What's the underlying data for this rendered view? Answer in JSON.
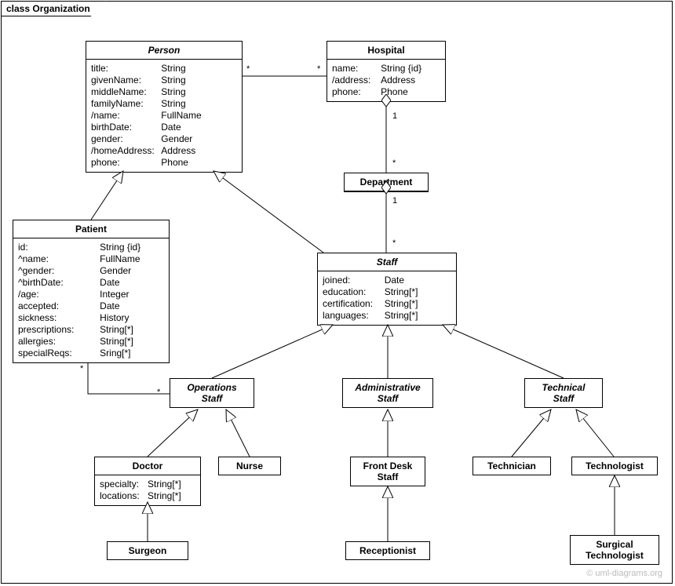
{
  "frame": {
    "label": "class Organization"
  },
  "watermark": "© uml-diagrams.org",
  "classes": {
    "person": {
      "name": "Person",
      "attrs": [
        {
          "n": "title:",
          "t": "String"
        },
        {
          "n": "givenName:",
          "t": "String"
        },
        {
          "n": "middleName:",
          "t": "String"
        },
        {
          "n": "familyName:",
          "t": "String"
        },
        {
          "n": "/name:",
          "t": "FullName"
        },
        {
          "n": "birthDate:",
          "t": "Date"
        },
        {
          "n": "gender:",
          "t": "Gender"
        },
        {
          "n": "/homeAddress:",
          "t": "Address"
        },
        {
          "n": "phone:",
          "t": "Phone"
        }
      ]
    },
    "hospital": {
      "name": "Hospital",
      "attrs": [
        {
          "n": "name:",
          "t": "String {id}"
        },
        {
          "n": "/address:",
          "t": "Address"
        },
        {
          "n": "phone:",
          "t": "Phone"
        }
      ]
    },
    "department": {
      "name": "Department"
    },
    "patient": {
      "name": "Patient",
      "attrs": [
        {
          "n": "id:",
          "t": "String {id}"
        },
        {
          "n": "^name:",
          "t": "FullName"
        },
        {
          "n": "^gender:",
          "t": "Gender"
        },
        {
          "n": "^birthDate:",
          "t": "Date"
        },
        {
          "n": "/age:",
          "t": "Integer"
        },
        {
          "n": "accepted:",
          "t": "Date"
        },
        {
          "n": "sickness:",
          "t": "History"
        },
        {
          "n": "prescriptions:",
          "t": "String[*]"
        },
        {
          "n": "allergies:",
          "t": "String[*]"
        },
        {
          "n": "specialReqs:",
          "t": "Sring[*]"
        }
      ]
    },
    "staff": {
      "name": "Staff",
      "attrs": [
        {
          "n": "joined:",
          "t": "Date"
        },
        {
          "n": "education:",
          "t": "String[*]"
        },
        {
          "n": "certification:",
          "t": "String[*]"
        },
        {
          "n": "languages:",
          "t": "String[*]"
        }
      ]
    },
    "opsStaff": {
      "name": "Operations",
      "name2": "Staff"
    },
    "adminStaff": {
      "name": "Administrative",
      "name2": "Staff"
    },
    "techStaff": {
      "name": "Technical",
      "name2": "Staff"
    },
    "doctor": {
      "name": "Doctor",
      "attrs": [
        {
          "n": "specialty:",
          "t": "String[*]"
        },
        {
          "n": "locations:",
          "t": "String[*]"
        }
      ]
    },
    "nurse": {
      "name": "Nurse"
    },
    "frontDesk": {
      "name": "Front Desk",
      "name2": "Staff"
    },
    "receptionist": {
      "name": "Receptionist"
    },
    "technician": {
      "name": "Technician"
    },
    "technologist": {
      "name": "Technologist"
    },
    "surgTech": {
      "name": "Surgical",
      "name2": "Technologist"
    },
    "surgeon": {
      "name": "Surgeon"
    }
  },
  "mults": {
    "ph1": "*",
    "ph2": "*",
    "hd1": "1",
    "hd2": "*",
    "ds1": "1",
    "ds2": "*",
    "po1": "*",
    "po2": "*"
  }
}
